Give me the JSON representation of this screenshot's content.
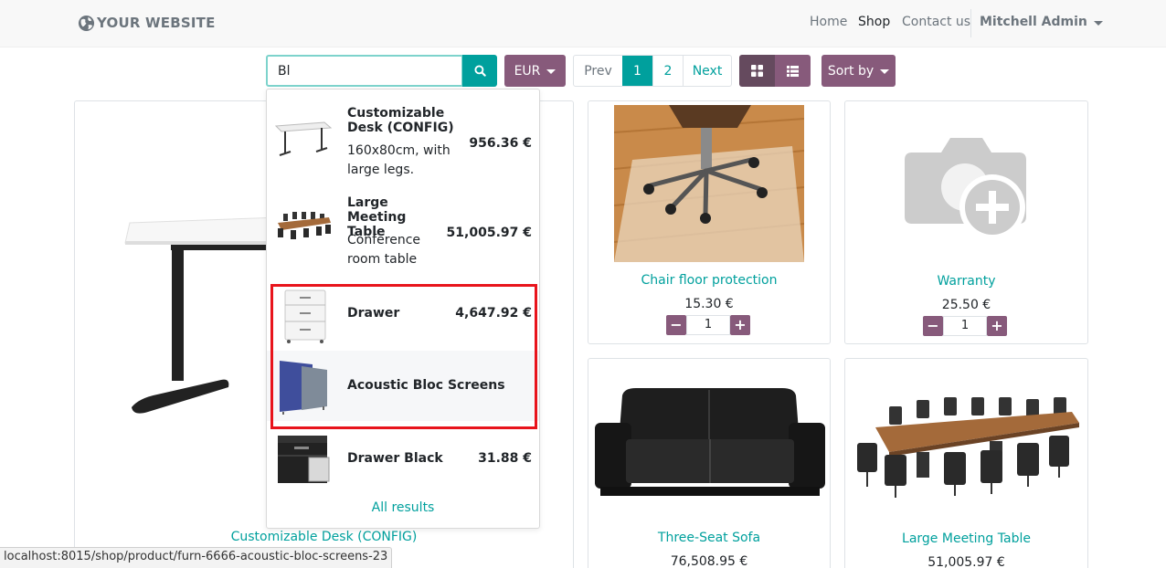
{
  "header": {
    "brand": "YOUR WEBSITE",
    "nav": [
      "Home",
      "Shop",
      "Contact us"
    ],
    "active_nav": "Shop",
    "user": "Mitchell Admin"
  },
  "toolbar": {
    "search_value": "Bl",
    "currency": "EUR",
    "pager": {
      "prev": "Prev",
      "pages": [
        "1",
        "2"
      ],
      "current": "1",
      "next": "Next"
    },
    "sort_label": "Sort by"
  },
  "autocomplete": {
    "items": [
      {
        "name": "Customizable Desk (CONFIG)",
        "description": "160x80cm, with large legs.",
        "price": "956.36 €"
      },
      {
        "name": "Large Meeting Table",
        "description": "Conference room table",
        "price": "51,005.97 €"
      },
      {
        "name": "Drawer",
        "description": "",
        "price": "4,647.92 €"
      },
      {
        "name": "Acoustic Bloc Screens",
        "description": "",
        "price": ""
      },
      {
        "name": "Drawer Black",
        "description": "",
        "price": "31.88 €"
      }
    ],
    "highlighted": [
      "Drawer",
      "Acoustic Bloc Screens"
    ],
    "hovered": "Acoustic Bloc Screens",
    "all_results": "All results"
  },
  "products": [
    {
      "name": "Customizable Desk (CONFIG)",
      "price": ""
    },
    {
      "name": "Chair floor protection",
      "price": "15.30 €",
      "qty": "1"
    },
    {
      "name": "Warranty",
      "price": "25.50 €",
      "qty": "1"
    },
    {
      "name": "Three-Seat Sofa",
      "price": "76,508.95 €"
    },
    {
      "name": "Large Meeting Table",
      "price": "51,005.97 €"
    }
  ],
  "status_bar": "localhost:8015/shop/product/furn-6666-acoustic-bloc-screens-23",
  "colors": {
    "primary": "#00a09d",
    "secondary": "#875a7b",
    "highlight": "#e8141c"
  }
}
